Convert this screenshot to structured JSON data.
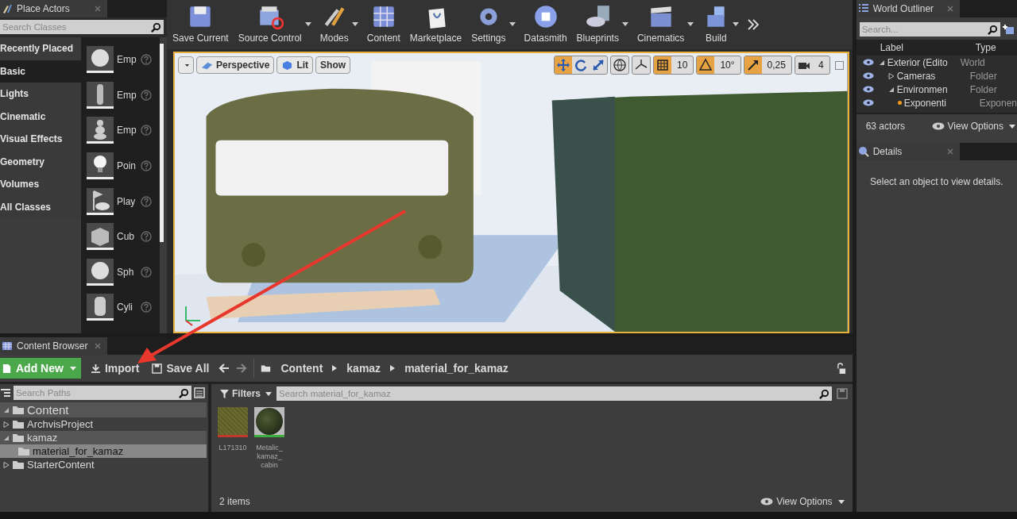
{
  "place_actors": {
    "title": "Place Actors",
    "search": {
      "placeholder": "Search Classes"
    },
    "categories": [
      {
        "label": "Recently Placed",
        "selected": false
      },
      {
        "label": "Basic",
        "selected": true
      },
      {
        "label": "Lights",
        "selected": false
      },
      {
        "label": "Cinematic",
        "selected": false
      },
      {
        "label": "Visual Effects",
        "selected": false
      },
      {
        "label": "Geometry",
        "selected": false
      },
      {
        "label": "Volumes",
        "selected": false
      },
      {
        "label": "All Classes",
        "selected": false
      }
    ],
    "items": [
      {
        "label": "Emp"
      },
      {
        "label": "Emp"
      },
      {
        "label": "Emp"
      },
      {
        "label": "Poin"
      },
      {
        "label": "Play"
      },
      {
        "label": "Cub"
      },
      {
        "label": "Sph"
      },
      {
        "label": "Cyli"
      }
    ]
  },
  "toolbar": [
    {
      "label": "Save Current",
      "has_menu": false
    },
    {
      "label": "Source Control",
      "has_menu": true
    },
    {
      "label": "Modes",
      "has_menu": true
    },
    {
      "label": "Content",
      "has_menu": false
    },
    {
      "label": "Marketplace",
      "has_menu": false
    },
    {
      "label": "Settings",
      "has_menu": true
    },
    {
      "label": "Datasmith",
      "has_menu": false
    },
    {
      "label": "Blueprints",
      "has_menu": true
    },
    {
      "label": "Cinematics",
      "has_menu": true
    },
    {
      "label": "Build",
      "has_menu": true
    }
  ],
  "viewport": {
    "buttons": [
      "Perspective",
      "Lit",
      "Show"
    ],
    "transform_modes": [
      {
        "selected": true
      },
      {
        "selected": false
      },
      {
        "selected": false
      }
    ],
    "snaps": [
      {
        "value": "10",
        "on": true
      },
      {
        "value": "10°",
        "on": true
      },
      {
        "value": "0,25",
        "on": true
      }
    ],
    "camera_speed": "4"
  },
  "world_outliner": {
    "title": "World Outliner",
    "search": {
      "placeholder": "Search..."
    },
    "columns": [
      "Label",
      "Type"
    ],
    "rows": [
      {
        "label": "Exterior (Edito",
        "type": "World",
        "visible": true,
        "expanded": true,
        "children": [
          {
            "label": "Cameras",
            "type": "Folder",
            "visible": true,
            "expanded": false
          },
          {
            "label": "Environmen",
            "type": "Folder",
            "visible": true,
            "expanded": true,
            "children": [
              {
                "label": "Exponenti",
                "type": "Exponen",
                "visible": true
              }
            ]
          }
        ]
      }
    ],
    "actor_count": "63 actors",
    "view_options": "View Options"
  },
  "details": {
    "title": "Details",
    "message": "Select an object to view details."
  },
  "content_browser": {
    "title": "Content Browser",
    "add_new": "Add New",
    "import": "Import",
    "save_all": "Save All",
    "breadcrumb": [
      "Content",
      "kamaz",
      "material_for_kamaz"
    ],
    "paths_search": {
      "placeholder": "Search Paths"
    },
    "tree": [
      {
        "label": "Content",
        "expanded": true,
        "selected": false,
        "children": [
          {
            "label": "ArchvisProject",
            "expanded": false,
            "selected": false
          },
          {
            "label": "kamaz",
            "expanded": true,
            "selected": false,
            "children": [
              {
                "label": "material_for_kamaz",
                "selected": true
              }
            ]
          },
          {
            "label": "StarterContent",
            "expanded": false,
            "selected": false
          }
        ]
      }
    ],
    "filters": "Filters",
    "asset_search": {
      "placeholder": "Search material_for_kamaz"
    },
    "assets": [
      {
        "label": "L171310",
        "color": "#c0392b",
        "kind": "texture"
      },
      {
        "label": "Metalic_kamaz_cabin",
        "color": "#3fae3f",
        "kind": "material"
      }
    ],
    "item_count": "2 items",
    "view_options": "View Options"
  }
}
